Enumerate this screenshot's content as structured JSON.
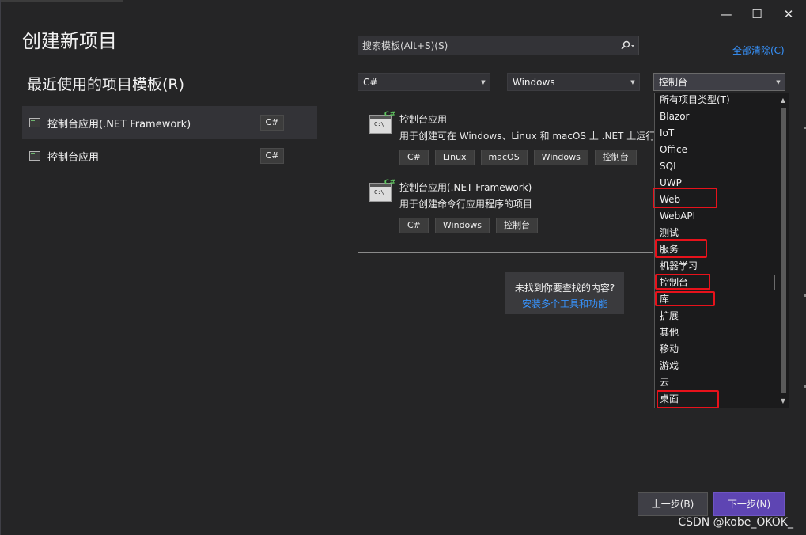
{
  "window": {
    "heading": "创建新项目",
    "controls": {
      "minimize": "—",
      "maximize": "☐",
      "close": "✕"
    }
  },
  "recent": {
    "title": "最近使用的项目模板(R)",
    "items": [
      {
        "label": "控制台应用(.NET Framework)",
        "lang": "C#"
      },
      {
        "label": "控制台应用",
        "lang": "C#"
      }
    ]
  },
  "search": {
    "placeholder": "搜索模板(Alt+S)(S)"
  },
  "clear_all": "全部清除(C)",
  "filters": {
    "language": "C#",
    "platform": "Windows",
    "project_type": "控制台"
  },
  "templates": [
    {
      "title": "控制台应用",
      "desc": "用于创建可在 Windows、Linux 和 macOS 上 .NET 上运行的",
      "tags": [
        "C#",
        "Linux",
        "macOS",
        "Windows",
        "控制台"
      ]
    },
    {
      "title": "控制台应用(.NET Framework)",
      "desc": "用于创建命令行应用程序的项目",
      "tags": [
        "C#",
        "Windows",
        "控制台"
      ]
    }
  ],
  "not_found": {
    "question": "未找到你要查找的内容?",
    "link": "安装多个工具和功能"
  },
  "dropdown": {
    "items": [
      "所有项目类型(T)",
      "Blazor",
      "IoT",
      "Office",
      "SQL",
      "UWP",
      "Web",
      "WebAPI",
      "测试",
      "服务",
      "机器学习",
      "控制台",
      "库",
      "扩展",
      "其他",
      "移动",
      "游戏",
      "云",
      "桌面"
    ],
    "highlighted": [
      "Web",
      "服务",
      "控制台",
      "库",
      "桌面"
    ]
  },
  "buttons": {
    "back": "上一步(B)",
    "next": "下一步(N)"
  },
  "watermark": "CSDN @kobe_OKOK_",
  "colors": {
    "accent": "#5e45b3",
    "link": "#3794ff",
    "annotation": "#e8121b"
  }
}
